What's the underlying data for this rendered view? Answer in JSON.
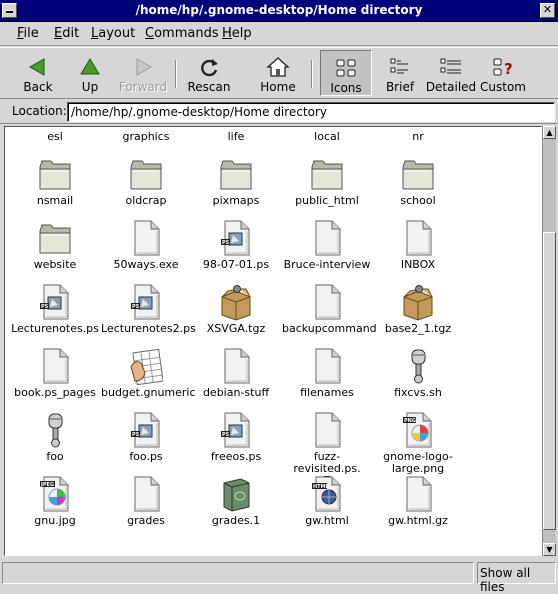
{
  "window": {
    "title": "/home/hp/.gnome-desktop/Home directory",
    "close_glyph": "✕"
  },
  "menubar": [
    {
      "label": "File",
      "mnemonic": "F",
      "rest": "ile"
    },
    {
      "label": "Edit",
      "mnemonic": "E",
      "rest": "dit"
    },
    {
      "label": "Layout",
      "mnemonic": "L",
      "rest": "ayout"
    },
    {
      "label": "Commands",
      "mnemonic": "C",
      "rest": "ommands"
    },
    {
      "label": "Help",
      "mnemonic": "H",
      "rest": "elp"
    }
  ],
  "toolbar": {
    "back": "Back",
    "up": "Up",
    "forward": "Forward",
    "rescan": "Rescan",
    "home": "Home",
    "icons": "Icons",
    "brief": "Brief",
    "detailed": "Detailed",
    "custom": "Custom",
    "icons_view_active": true,
    "forward_enabled": false
  },
  "location": {
    "label": "Location:",
    "value": "/home/hp/.gnome-desktop/Home directory"
  },
  "files": [
    {
      "name": "esl",
      "icon": "folder-icon"
    },
    {
      "name": "graphics",
      "icon": "folder-icon"
    },
    {
      "name": "life",
      "icon": "folder-icon"
    },
    {
      "name": "local",
      "icon": "folder-icon"
    },
    {
      "name": "nr",
      "icon": "folder-icon"
    },
    {
      "name": "nsmail",
      "icon": "folder-icon"
    },
    {
      "name": "oldcrap",
      "icon": "folder-icon"
    },
    {
      "name": "pixmaps",
      "icon": "folder-icon"
    },
    {
      "name": "public_html",
      "icon": "folder-icon"
    },
    {
      "name": "school",
      "icon": "folder-icon"
    },
    {
      "name": "website",
      "icon": "folder-icon"
    },
    {
      "name": "50ways.exe",
      "icon": "document-icon"
    },
    {
      "name": "98-07-01.ps",
      "icon": "postscript-icon"
    },
    {
      "name": "Bruce-interview",
      "icon": "document-icon"
    },
    {
      "name": "INBOX",
      "icon": "document-icon"
    },
    {
      "name": "Lecturenotes.ps",
      "icon": "postscript-icon"
    },
    {
      "name": "Lecturenotes2.ps",
      "icon": "postscript-icon"
    },
    {
      "name": "XSVGA.tgz",
      "icon": "tarball-box-icon"
    },
    {
      "name": "backupcommand",
      "icon": "document-icon"
    },
    {
      "name": "base2_1.tgz",
      "icon": "tarball-box-icon"
    },
    {
      "name": "book.ps_pages",
      "icon": "document-icon"
    },
    {
      "name": "budget.gnumeric",
      "icon": "spreadsheet-icon"
    },
    {
      "name": "debian-stuff",
      "icon": "document-icon"
    },
    {
      "name": "filenames",
      "icon": "document-icon"
    },
    {
      "name": "fixcvs.sh",
      "icon": "script-piston-icon"
    },
    {
      "name": "foo",
      "icon": "script-piston-icon"
    },
    {
      "name": "foo.ps",
      "icon": "postscript-icon"
    },
    {
      "name": "freeos.ps",
      "icon": "postscript-icon"
    },
    {
      "name": "fuzz-revisited.ps.\nZ",
      "icon": "document-icon"
    },
    {
      "name": "gnome-logo-\nlarge.png",
      "icon": "png-image-icon"
    },
    {
      "name": "gnu.jpg",
      "icon": "jpeg-image-icon"
    },
    {
      "name": "grades",
      "icon": "document-icon"
    },
    {
      "name": "grades.1",
      "icon": "green-book-icon"
    },
    {
      "name": "gw.html",
      "icon": "html-document-icon"
    },
    {
      "name": "gw.html.gz",
      "icon": "document-icon"
    }
  ],
  "scroll": {
    "position_fraction": 0.25,
    "up_arrow": "▲",
    "down_arrow": "▼"
  },
  "statusbar": {
    "text": "",
    "show_all": "Show all files"
  },
  "colors": {
    "titlebar": "#00007b",
    "window_bg": "#d6d6d6",
    "view_bg": "#ffffff"
  }
}
